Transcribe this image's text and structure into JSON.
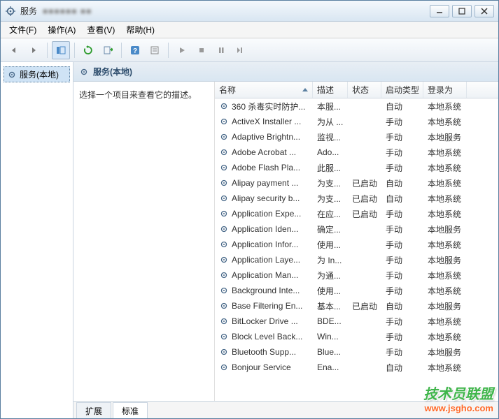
{
  "window": {
    "title": "服务",
    "blur_text": "■■■■■■  ■■"
  },
  "menubar": {
    "file": "文件(F)",
    "action": "操作(A)",
    "view": "查看(V)",
    "help": "帮助(H)"
  },
  "tree": {
    "root": "服务(本地)"
  },
  "main": {
    "header": "服务(本地)",
    "desc_prompt": "选择一个项目来查看它的描述。"
  },
  "columns": {
    "name": "名称",
    "desc": "描述",
    "status": "状态",
    "start": "启动类型",
    "logon": "登录为"
  },
  "tabs": {
    "extended": "扩展",
    "standard": "标准"
  },
  "services": [
    {
      "name": "360 杀毒实时防护...",
      "desc": "本服...",
      "status": "",
      "start": "自动",
      "logon": "本地系统"
    },
    {
      "name": "ActiveX Installer ...",
      "desc": "为从 ...",
      "status": "",
      "start": "手动",
      "logon": "本地系统"
    },
    {
      "name": "Adaptive Brightn...",
      "desc": "监视...",
      "status": "",
      "start": "手动",
      "logon": "本地服务"
    },
    {
      "name": "Adobe Acrobat ...",
      "desc": "Ado...",
      "status": "",
      "start": "手动",
      "logon": "本地系统"
    },
    {
      "name": "Adobe Flash Pla...",
      "desc": "此服...",
      "status": "",
      "start": "手动",
      "logon": "本地系统"
    },
    {
      "name": "Alipay payment ...",
      "desc": "为支...",
      "status": "已启动",
      "start": "自动",
      "logon": "本地系统"
    },
    {
      "name": "Alipay security b...",
      "desc": "为支...",
      "status": "已启动",
      "start": "自动",
      "logon": "本地系统"
    },
    {
      "name": "Application Expe...",
      "desc": "在应...",
      "status": "已启动",
      "start": "手动",
      "logon": "本地系统"
    },
    {
      "name": "Application Iden...",
      "desc": "确定...",
      "status": "",
      "start": "手动",
      "logon": "本地服务"
    },
    {
      "name": "Application Infor...",
      "desc": "使用...",
      "status": "",
      "start": "手动",
      "logon": "本地系统"
    },
    {
      "name": "Application Laye...",
      "desc": "为 In...",
      "status": "",
      "start": "手动",
      "logon": "本地服务"
    },
    {
      "name": "Application Man...",
      "desc": "为通...",
      "status": "",
      "start": "手动",
      "logon": "本地系统"
    },
    {
      "name": "Background Inte...",
      "desc": "使用...",
      "status": "",
      "start": "手动",
      "logon": "本地系统"
    },
    {
      "name": "Base Filtering En...",
      "desc": "基本...",
      "status": "已启动",
      "start": "自动",
      "logon": "本地服务"
    },
    {
      "name": "BitLocker Drive ...",
      "desc": "BDE...",
      "status": "",
      "start": "手动",
      "logon": "本地系统"
    },
    {
      "name": "Block Level Back...",
      "desc": "Win...",
      "status": "",
      "start": "手动",
      "logon": "本地系统"
    },
    {
      "name": "Bluetooth Supp...",
      "desc": "Blue...",
      "status": "",
      "start": "手动",
      "logon": "本地服务"
    },
    {
      "name": "Bonjour Service",
      "desc": "Ena...",
      "status": "",
      "start": "自动",
      "logon": "本地系统"
    }
  ],
  "watermark": {
    "line1": "技术员联盟",
    "line2": "www.jsgho.com"
  }
}
